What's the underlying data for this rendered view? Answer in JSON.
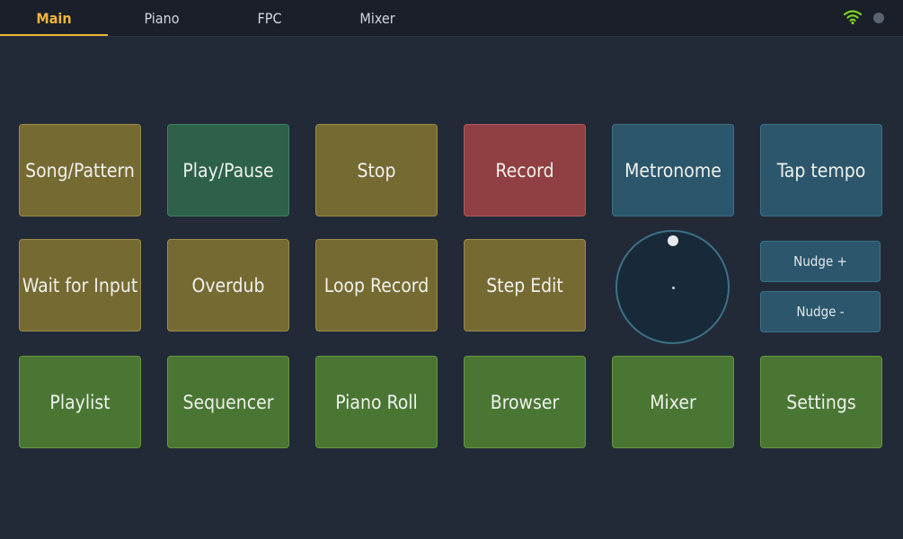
{
  "tabs": [
    {
      "label": "Main",
      "active": true
    },
    {
      "label": "Piano",
      "active": false
    },
    {
      "label": "FPC",
      "active": false
    },
    {
      "label": "Mixer",
      "active": false
    }
  ],
  "status": {
    "wifi_icon": "wifi-icon",
    "status_dot_icon": "status-dot-icon",
    "accent_color": "#f2b53a"
  },
  "pads": {
    "row1": [
      "Song/Pattern",
      "Play/Pause",
      "Stop",
      "Record",
      "Metronome",
      "Tap tempo"
    ],
    "row2": [
      "Wait for Input",
      "Overdub",
      "Loop Record",
      "Step Edit"
    ],
    "row3": [
      "Playlist",
      "Sequencer",
      "Piano Roll",
      "Browser",
      "Mixer",
      "Settings"
    ]
  },
  "nudge": {
    "plus": "Nudge +",
    "minus": "Nudge -"
  },
  "colors": {
    "olive": "#766a33",
    "teal": "#2d6149",
    "red": "#903f42",
    "blue": "#2c566b",
    "green": "#4a7634"
  }
}
